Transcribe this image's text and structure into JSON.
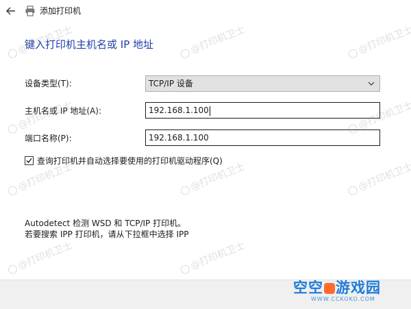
{
  "window": {
    "title": "添加打印机"
  },
  "heading": "键入打印机主机名或 IP 地址",
  "form": {
    "device_type": {
      "label": "设备类型(T):",
      "value": "TCP/IP 设备"
    },
    "hostname": {
      "label": "主机名或 IP 地址(A):",
      "value": "192.168.1.100"
    },
    "port_name": {
      "label": "端口名称(P):",
      "value": "192.168.1.100"
    },
    "query_printer": {
      "label": "查询打印机并自动选择要使用的打印机驱动程序(Q)",
      "checked": true
    }
  },
  "info": {
    "line1": "Autodetect 检测 WSD 和 TCP/IP 打印机。",
    "line2": "若要搜索 IPP 打印机，请从下拉框中选择 IPP"
  },
  "watermark": {
    "text": "@打印机卫士"
  },
  "logo": {
    "left": "空空",
    "right": "游戏园",
    "sub": "WWW.CCKOKO.COM"
  },
  "icons": {
    "back": "arrow-left-icon",
    "printer": "printer-icon",
    "dropdown": "chevron-down-icon",
    "check": "checkmark-icon"
  },
  "colors": {
    "heading": "#1f3fa8",
    "logo_blue": "#1f7bd9",
    "logo_orange": "#ff6b2c"
  }
}
